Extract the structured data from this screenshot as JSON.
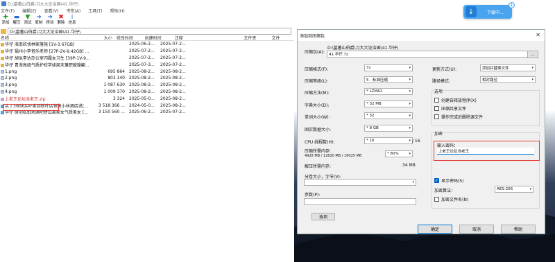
{
  "file_manager": {
    "title": "D:\\墓著山伯爵\\习大大论治国\\41.华仔\\",
    "menu": [
      "文件(F)",
      "编辑(E)",
      "查看(V)",
      "书签(A)",
      "工具(T)",
      "帮助(H)"
    ],
    "toolbar": [
      {
        "label": "添加",
        "icon": "add-icon",
        "glyph": "✚",
        "color": "#1aa31a"
      },
      {
        "label": "解压",
        "icon": "extract-icon",
        "glyph": "▬",
        "color": "#2a6ad8"
      },
      {
        "label": "测试",
        "icon": "test-icon",
        "glyph": "▼",
        "color": "#1aa31a"
      },
      {
        "label": "复制",
        "icon": "copy-icon",
        "glyph": "➜",
        "color": "#2a6ad8"
      },
      {
        "label": "移动",
        "icon": "move-icon",
        "glyph": "➜",
        "color": "#2a6ad8"
      },
      {
        "label": "删除",
        "icon": "delete-icon",
        "glyph": "✖",
        "color": "#d92020"
      },
      {
        "label": "信息",
        "icon": "info-icon",
        "glyph": "i",
        "color": "#2a6ad8"
      }
    ],
    "path": "D:\\墓著山伯爵\\习大大论治国\\41.华仔\\",
    "columns": {
      "name": "名称",
      "size": "大小",
      "modified": "修改时间",
      "created": "创建时间",
      "comment": "注释",
      "folders": "文件夹",
      "files": "文件"
    },
    "rows": [
      {
        "type": "folder",
        "name": "华仔 海南砍伐林家落施 [1V-3.67GB]",
        "size": "",
        "modified": "2025-06-2...",
        "created": "2025-07-2..."
      },
      {
        "type": "folder",
        "name": "华仔 福州小李音乐老师 [27P-2V-9.42GB] ...",
        "size": "",
        "modified": "2025-07-2...",
        "created": "2025-07-2..."
      },
      {
        "type": "folder",
        "name": "华仔 胡似李达办公室闪霜女习生 [39P-1V-9...",
        "size": "",
        "modified": "2025-07-2...",
        "created": "2025-07-2..."
      },
      {
        "type": "folder",
        "name": "华仔 青海高级气质护校学妹周末兼职被操翻...",
        "size": "",
        "modified": "2025-07-3...",
        "created": "2025-07-2..."
      },
      {
        "type": "png",
        "name": "1.png",
        "size": "695 864",
        "modified": "2025-08-2...",
        "created": "2025-08-2..."
      },
      {
        "type": "png",
        "name": "2.png",
        "size": "803 140",
        "modified": "2025-08-2...",
        "created": "2025-08-2..."
      },
      {
        "type": "png",
        "name": "3.png",
        "size": "1 087 630",
        "modified": "2025-08-2...",
        "created": "2025-08-2..."
      },
      {
        "type": "png",
        "name": "4.png",
        "size": "1 009 370",
        "modified": "2025-08-2...",
        "created": "2025-08-2..."
      },
      {
        "type": "zip",
        "name": "上老王论坛当老王.zip",
        "size": "3 324",
        "modified": "2025-05-0...",
        "created": "2025-08-2..."
      },
      {
        "type": "exe",
        "name": "买了3W块买吓家到新叶店销售小林酒店说(...",
        "size": "3 518 366 ...",
        "modified": "2024-05-0...",
        "created": "2025-08-2..."
      },
      {
        "type": "exe",
        "name": "华仔 原创私拍场酒吧拼山离家女气质美女 [...",
        "size": "3 150 560 ...",
        "modified": "2025-06-2...",
        "created": "2025-07-2..."
      }
    ]
  },
  "download_toast": {
    "text": "下载中...",
    "badge": "1"
  },
  "dialog": {
    "title": "添加到压缩包",
    "archive_label": "压缩包(A):",
    "archive_dir": "D:\\墓著山伯爵\\习大大论治国\\41.华仔\\",
    "archive_name": "41.华仔.7z",
    "browse": "...",
    "format_label": "压缩格式(F):",
    "format_value": "7z",
    "level_label": "压缩等级(L):",
    "level_value": "5 - 标准压缩",
    "method_label": "压缩方法(M):",
    "method_value": "* LZMA2",
    "dict_label": "字典大小(D):",
    "dict_value": "* 32 MB",
    "word_label": "单词大小(W):",
    "word_value": "* 32",
    "solid_label": "固实数据大小:",
    "solid_value": "* 8 GB",
    "threads_label": "CPU 线程数(H):",
    "threads_value": "* 16",
    "threads_total": "/ 16",
    "mem_label": "压缩所需内存:",
    "mem_detail": "4928 MB / 12820 MB / 16025 MB",
    "mem_value": "* 80%",
    "decomp_label": "解压所需内存:",
    "decomp_value": "34 MB",
    "split_label": "分卷大小，字节(V):",
    "params_label": "参数(P):",
    "options_button": "选项",
    "update_label": "更新方式(U):",
    "update_value": "添加并替换文件",
    "path_label": "路径模式:",
    "path_value": "相对路径",
    "options_group": "选项",
    "opt_sfx": "创建自释放程序(X)",
    "opt_shared": "压缩共享文件",
    "opt_delete": "操作完成后删除源文件",
    "encrypt_group": "加密",
    "password_label": "输入密码：",
    "password_value": "上老王论坛当老王",
    "show_password": "显示密码(S)",
    "enc_method_label": "加密算法：",
    "enc_method_value": "AES-256",
    "enc_names": "加密文件名(N)",
    "ok": "确定",
    "cancel": "取消",
    "help": "帮助"
  }
}
